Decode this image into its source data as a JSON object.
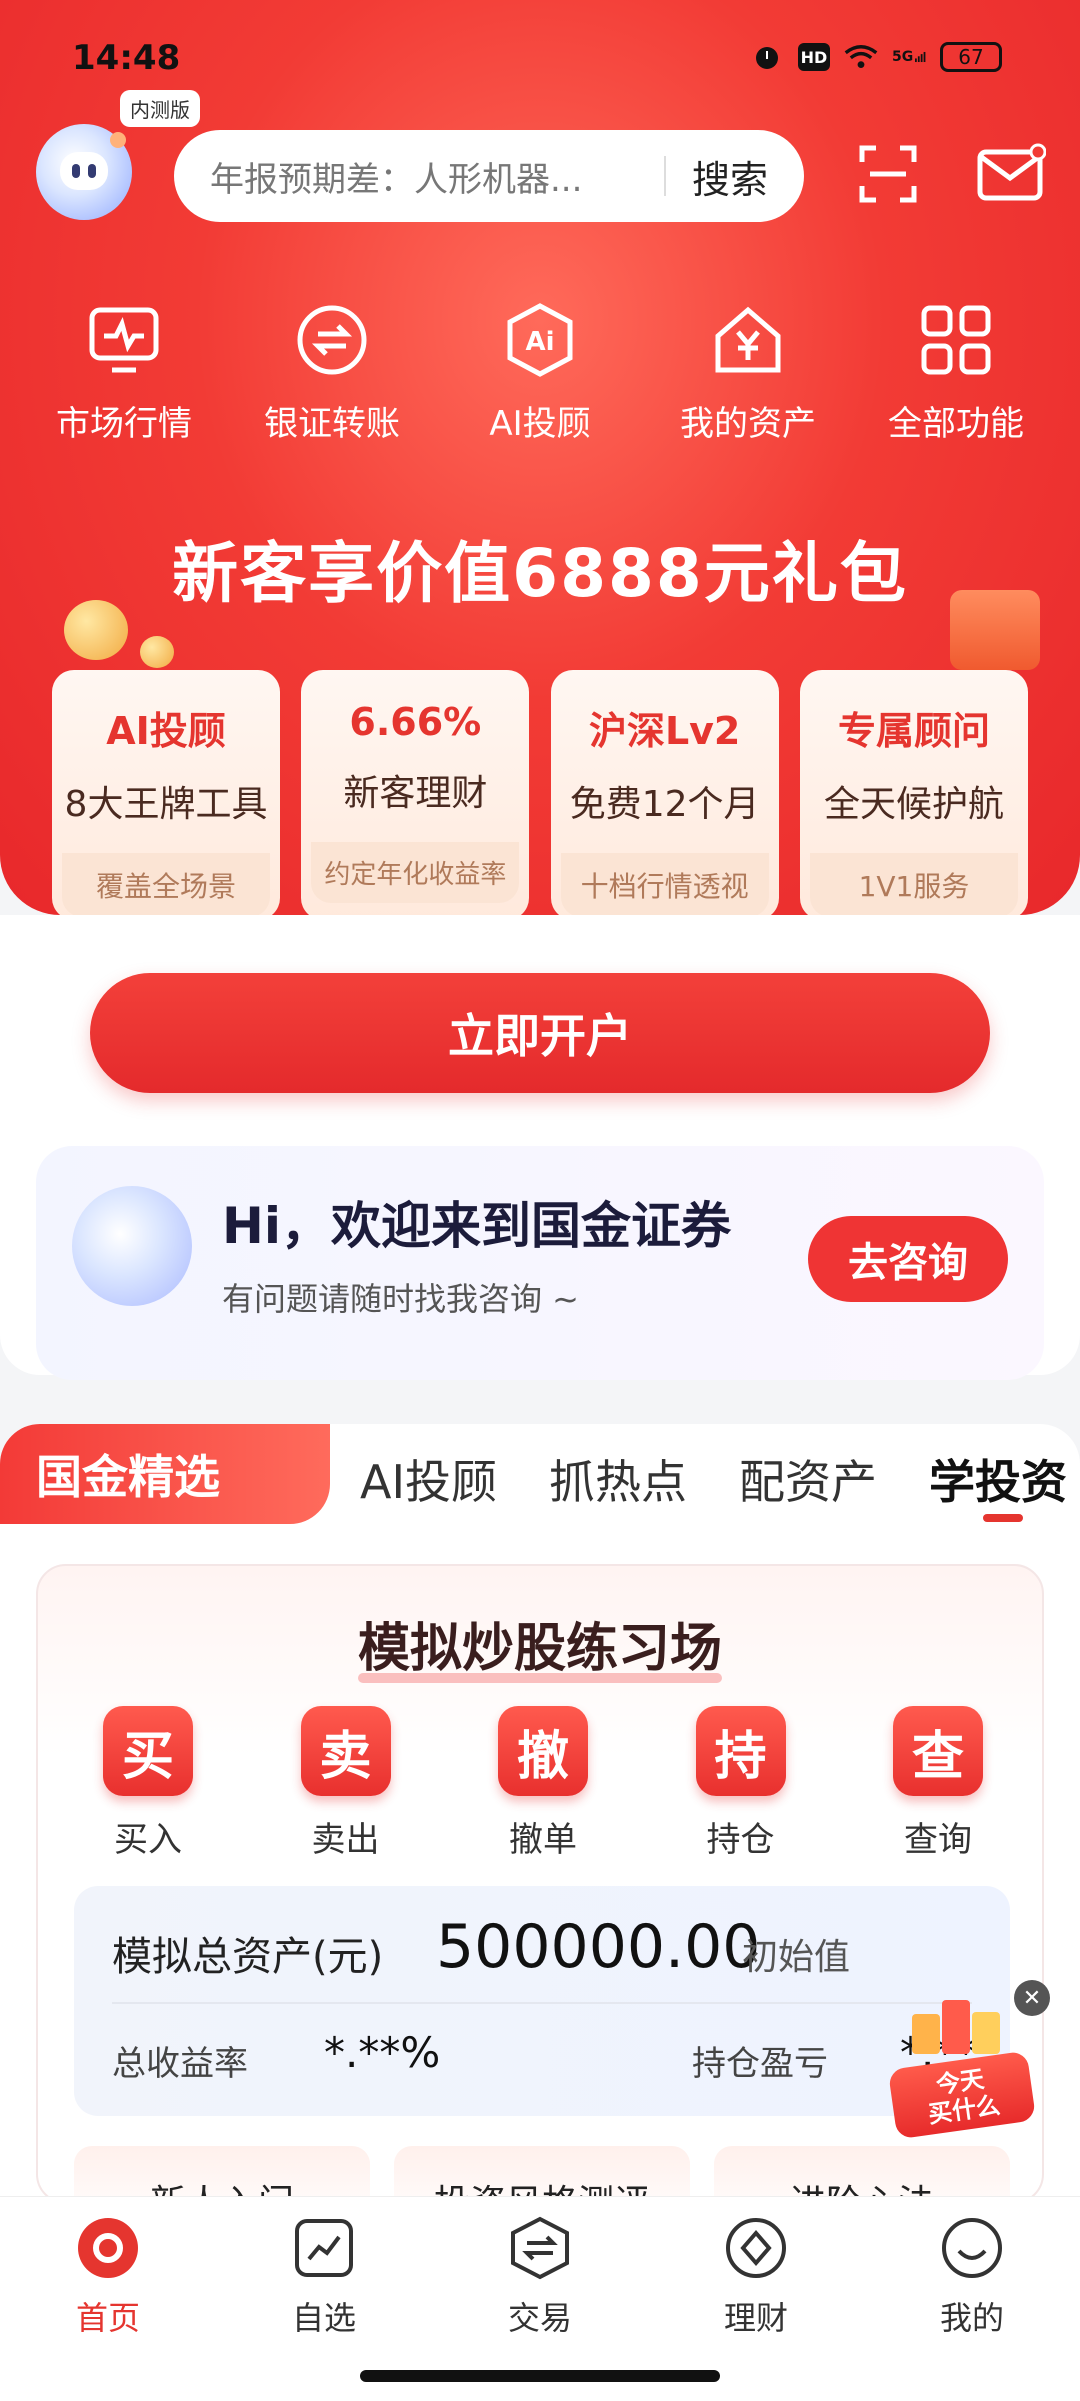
{
  "status_bar": {
    "time": "14:48",
    "battery": "67",
    "network": "5G",
    "hd": "HD"
  },
  "header": {
    "beta_badge": "内测版",
    "search_placeholder": "年报预期差：人形机器...",
    "search_button": "搜索"
  },
  "quick_actions": [
    {
      "label": "市场行情",
      "icon": "monitor-chart-icon"
    },
    {
      "label": "银证转账",
      "icon": "transfer-icon"
    },
    {
      "label": "AI投顾",
      "icon": "ai-icon"
    },
    {
      "label": "我的资产",
      "icon": "asset-home-icon"
    },
    {
      "label": "全部功能",
      "icon": "grid-icon"
    }
  ],
  "promo": {
    "title": "新客享价值6888元礼包",
    "cards": [
      {
        "t1": "AI投顾",
        "t2": "8大王牌工具",
        "t3": "覆盖全场景"
      },
      {
        "t1": "6.66%",
        "t2": "新客理财",
        "t3": "约定年化收益率"
      },
      {
        "t1": "沪深Lv2",
        "t2": "免费12个月",
        "t3": "十档行情透视"
      },
      {
        "t1": "专属顾问",
        "t2": "全天候护航",
        "t3": "1V1服务"
      }
    ],
    "open_button": "立即开户"
  },
  "welcome": {
    "title": "Hi，欢迎来到国金证券",
    "subtitle": "有问题请随时找我咨询 ~",
    "button": "去咨询"
  },
  "tabs": {
    "active": "国金精选",
    "items": [
      "AI投顾",
      "抓热点",
      "配资产",
      "学投资"
    ]
  },
  "sim": {
    "title": "模拟炒股练习场",
    "ops": [
      {
        "char": "买",
        "label": "买入"
      },
      {
        "char": "卖",
        "label": "卖出"
      },
      {
        "char": "撤",
        "label": "撤单"
      },
      {
        "char": "持",
        "label": "持仓"
      },
      {
        "char": "查",
        "label": "查询"
      }
    ],
    "assets_label": "模拟总资产(元)",
    "assets_value": "500000.00",
    "assets_init": "初始值",
    "rate_label": "总收益率",
    "rate_value": "*.**%",
    "pnl_label": "持仓盈亏",
    "pnl_value": "*.**",
    "mini_cards": [
      "新人入门",
      "投资风格测评",
      "进阶心法"
    ]
  },
  "float_ad": {
    "line1": "今天",
    "line2": "买什么"
  },
  "nav": [
    {
      "label": "首页",
      "icon": "home-icon"
    },
    {
      "label": "自选",
      "icon": "watchlist-icon"
    },
    {
      "label": "交易",
      "icon": "trade-icon"
    },
    {
      "label": "理财",
      "icon": "wealth-icon"
    },
    {
      "label": "我的",
      "icon": "profile-icon"
    }
  ],
  "colors": {
    "brand_red": "#e5352f",
    "card_text": "#4a2a20"
  }
}
